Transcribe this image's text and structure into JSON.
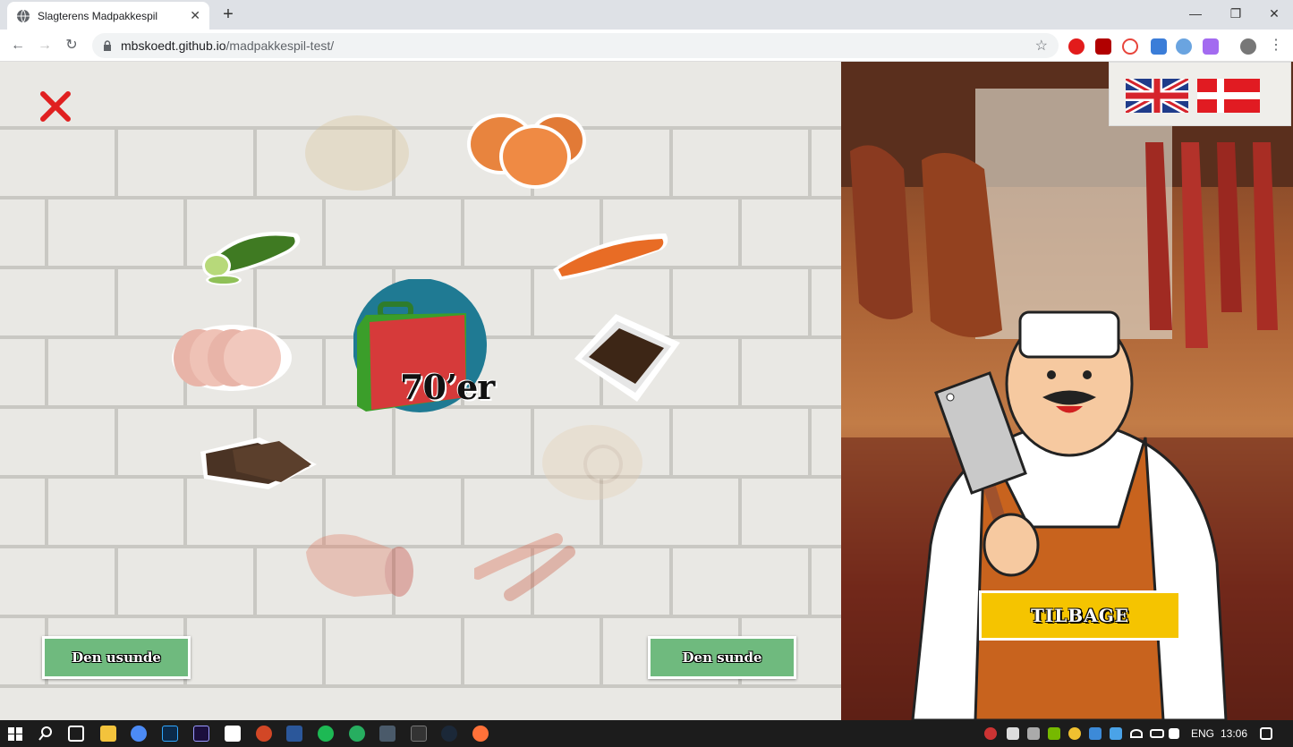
{
  "browser": {
    "tab_title": "Slagterens Madpakkespil",
    "url_host": "mbskoedt.github.io",
    "url_path": "/madpakkespil-test/",
    "new_tab_symbol": "+",
    "close_tab_symbol": "✕",
    "window_controls": [
      "—",
      "❐",
      "✕"
    ]
  },
  "game": {
    "lunchbox_label": "70’er",
    "unhealthy_button": "Den usunde",
    "healthy_button": "Den sunde",
    "foods": [
      {
        "name": "potato",
        "faded": true
      },
      {
        "name": "eggs",
        "faded": false
      },
      {
        "name": "cucumber",
        "faded": false
      },
      {
        "name": "carrot",
        "faded": false
      },
      {
        "name": "sliced-ham",
        "faded": false
      },
      {
        "name": "liver-pate",
        "faded": false
      },
      {
        "name": "rye-bread",
        "faded": false
      },
      {
        "name": "rullepolse",
        "faded": true
      },
      {
        "name": "salami",
        "faded": true
      },
      {
        "name": "sausages",
        "faded": true
      }
    ]
  },
  "shop": {
    "back_button": "TILBAGE",
    "flags": [
      "uk-flag",
      "danish-flag"
    ]
  },
  "taskbar": {
    "language": "ENG",
    "time": "13:06"
  },
  "colors": {
    "green_button": "#6fba7e",
    "yellow_button": "#f5c400",
    "close_x": "#e02020",
    "lunchbox_circle": "#1f7a93"
  }
}
